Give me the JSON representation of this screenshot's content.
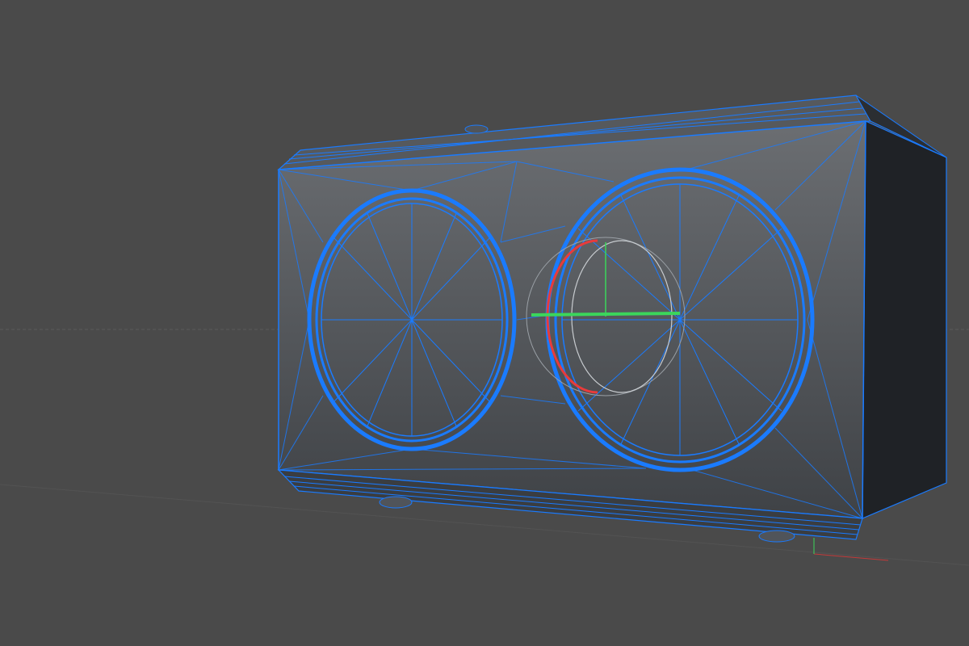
{
  "viewport": {
    "colors": {
      "background": "#4a4a4a",
      "grid_line": "#5c5c5c",
      "wire": "#1a7bff",
      "front_face_top": "#6b6e72",
      "front_face_bottom": "#3f4246",
      "side_face": "#1f2226",
      "gizmo_x": "#e83b3b",
      "gizmo_y": "#3bd65b",
      "gizmo_ring": "#9aa0a6"
    },
    "icons": [
      "move-gizmo-icon",
      "world-axis-icon"
    ]
  }
}
